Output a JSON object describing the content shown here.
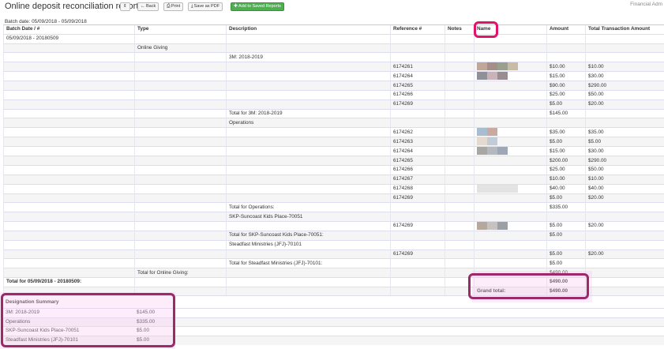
{
  "header": {
    "title": "Online deposit reconciliation report",
    "toggle_label": "⇕",
    "back_label": "Back",
    "print_label": "Print",
    "save_pdf_label": "Save as PDF",
    "add_saved_label": "Add to Saved Reports",
    "user_label": "Financial Adm"
  },
  "batch_date": "Batch date: 05/09/2018 - 05/09/2018",
  "columns": [
    "Batch Date / #",
    "Type",
    "Description",
    "Reference #",
    "Notes",
    "Name",
    "Amount",
    "Total Transaction Amount"
  ],
  "rows": [
    {
      "batch": "05/09/2018 - 20180509",
      "type": "",
      "desc": "",
      "ref": "",
      "notes": "",
      "amount": "",
      "total": ""
    },
    {
      "batch": "",
      "type": "Online Giving",
      "desc": "",
      "ref": "",
      "notes": "",
      "amount": "",
      "total": ""
    },
    {
      "batch": "",
      "type": "",
      "desc": "3M: 2018-2019",
      "ref": "",
      "notes": "",
      "amount": "",
      "total": ""
    },
    {
      "batch": "",
      "type": "",
      "desc": "",
      "ref": "6174261",
      "notes": "",
      "amount": "$10.00",
      "total": "$10.00"
    },
    {
      "batch": "",
      "type": "",
      "desc": "",
      "ref": "6174264",
      "notes": "",
      "amount": "$15.00",
      "total": "$30.00"
    },
    {
      "batch": "",
      "type": "",
      "desc": "",
      "ref": "6174265",
      "notes": "",
      "amount": "$90.00",
      "total": "$290.00"
    },
    {
      "batch": "",
      "type": "",
      "desc": "",
      "ref": "6174266",
      "notes": "",
      "amount": "$25.00",
      "total": "$50.00"
    },
    {
      "batch": "",
      "type": "",
      "desc": "",
      "ref": "6174269",
      "notes": "",
      "amount": "$5.00",
      "total": "$20.00"
    },
    {
      "batch": "",
      "type": "",
      "desc": "Total for 3M: 2018-2019",
      "ref": "",
      "notes": "",
      "amount": "$145.00",
      "total": ""
    },
    {
      "batch": "",
      "type": "",
      "desc": "Operations",
      "ref": "",
      "notes": "",
      "amount": "",
      "total": ""
    },
    {
      "batch": "",
      "type": "",
      "desc": "",
      "ref": "6174262",
      "notes": "",
      "amount": "$35.00",
      "total": "$35.00"
    },
    {
      "batch": "",
      "type": "",
      "desc": "",
      "ref": "6174263",
      "notes": "",
      "amount": "$5.00",
      "total": "$5.00"
    },
    {
      "batch": "",
      "type": "",
      "desc": "",
      "ref": "6174264",
      "notes": "",
      "amount": "$15.00",
      "total": "$30.00"
    },
    {
      "batch": "",
      "type": "",
      "desc": "",
      "ref": "6174265",
      "notes": "",
      "amount": "$200.00",
      "total": "$290.00"
    },
    {
      "batch": "",
      "type": "",
      "desc": "",
      "ref": "6174266",
      "notes": "",
      "amount": "$25.00",
      "total": "$50.00"
    },
    {
      "batch": "",
      "type": "",
      "desc": "",
      "ref": "6174267",
      "notes": "",
      "amount": "$10.00",
      "total": "$10.00"
    },
    {
      "batch": "",
      "type": "",
      "desc": "",
      "ref": "6174268",
      "notes": "",
      "amount": "$40.00",
      "total": "$40.00"
    },
    {
      "batch": "",
      "type": "",
      "desc": "",
      "ref": "6174269",
      "notes": "",
      "amount": "$5.00",
      "total": "$20.00"
    },
    {
      "batch": "",
      "type": "",
      "desc": "Total for Operations:",
      "ref": "",
      "notes": "",
      "amount": "$335.00",
      "total": ""
    },
    {
      "batch": "",
      "type": "",
      "desc": "SKP-Suncoast Kids Place-70051",
      "ref": "",
      "notes": "",
      "amount": "",
      "total": ""
    },
    {
      "batch": "",
      "type": "",
      "desc": "",
      "ref": "6174269",
      "notes": "",
      "amount": "$5.00",
      "total": "$20.00"
    },
    {
      "batch": "",
      "type": "",
      "desc": "Total for SKP-Suncoast Kids Place-70051:",
      "ref": "",
      "notes": "",
      "amount": "$5.00",
      "total": ""
    },
    {
      "batch": "",
      "type": "",
      "desc": "Steadfast Ministries (JFJ)-70101",
      "ref": "",
      "notes": "",
      "amount": "",
      "total": ""
    },
    {
      "batch": "",
      "type": "",
      "desc": "",
      "ref": "6174269",
      "notes": "",
      "amount": "$5.00",
      "total": "$20.00"
    },
    {
      "batch": "",
      "type": "",
      "desc": "Total for Steadfast Ministries (JFJ)-70101:",
      "ref": "",
      "notes": "",
      "amount": "$5.00",
      "total": ""
    },
    {
      "batch": "",
      "type": "Total for Online Giving:",
      "desc": "",
      "ref": "",
      "notes": "",
      "amount": "$490.00",
      "total": ""
    },
    {
      "batch": "Total for 05/09/2018 - 20180509:",
      "type": "",
      "desc": "",
      "ref": "",
      "notes": "",
      "amount": "$490.00",
      "total": "",
      "bold": true
    },
    {
      "batch": "",
      "type": "",
      "desc": "",
      "ref": "",
      "notes": "",
      "name": "Grand total:",
      "amount": "$490.00",
      "total": "",
      "bold": true
    }
  ],
  "summary": {
    "title": "Designation Summary",
    "items": [
      {
        "label": "3M: 2018-2019",
        "amount": "$145.00"
      },
      {
        "label": "Operations",
        "amount": "$335.00"
      },
      {
        "label": "SKP-Suncoast Kids Place-70051",
        "amount": "$5.00"
      },
      {
        "label": "Steadfast Ministries (JFJ)-70101",
        "amount": "$5.00"
      }
    ]
  },
  "colors": {
    "highlight_pink": "#e0136a",
    "highlight_plum": "#9c2a6b",
    "button_green": "#4caf50"
  }
}
